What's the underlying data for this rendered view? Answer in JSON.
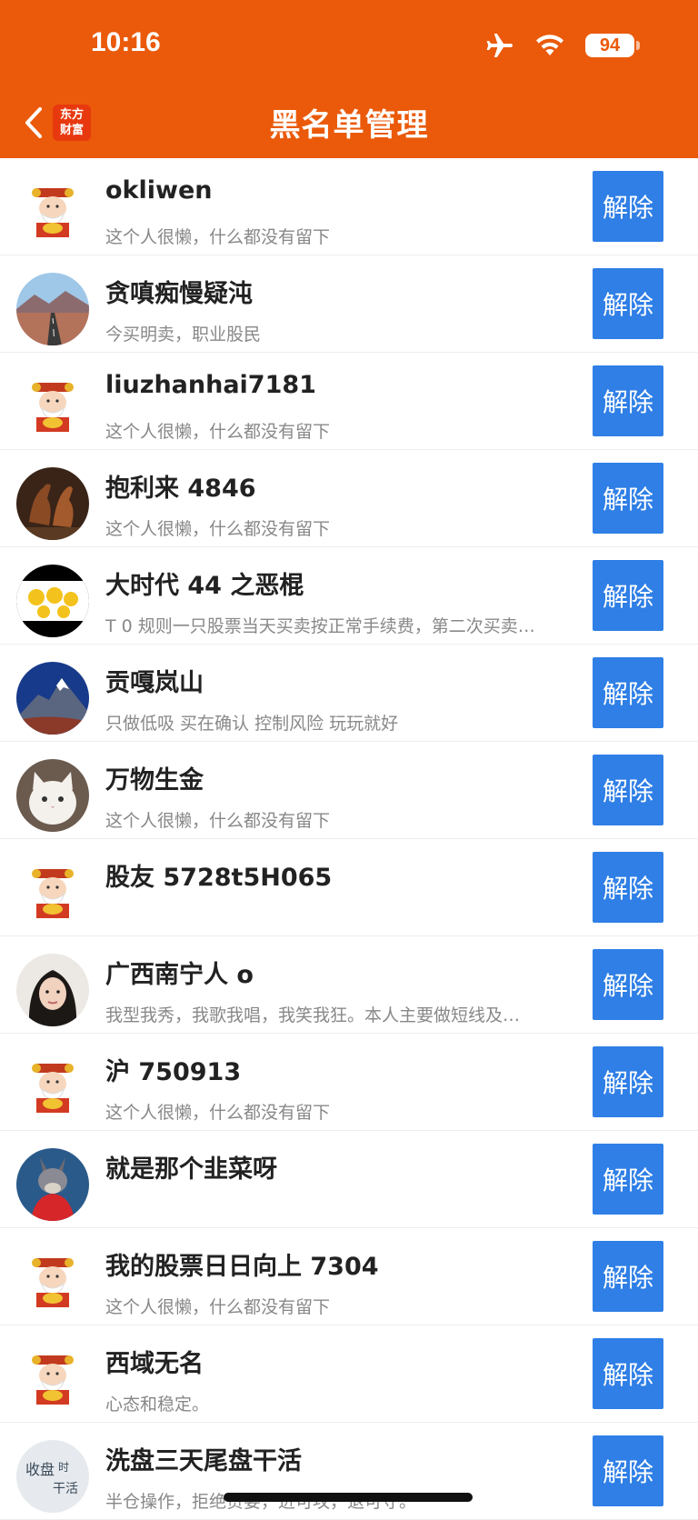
{
  "status_bar": {
    "time": "10:16",
    "battery": "94"
  },
  "header": {
    "logo": "东方\n财富",
    "title": "黑名单管理"
  },
  "users": [
    {
      "name": "okliwen",
      "bio": "这个人很懒，什么都没有留下",
      "avatar": "mascot",
      "button": "解除"
    },
    {
      "name": "贪嗔痴慢疑沌",
      "bio": "今买明卖，职业股民",
      "avatar": "road-landscape",
      "button": "解除"
    },
    {
      "name": "liuzhanhai7181",
      "bio": "这个人很懒，什么都没有留下",
      "avatar": "mascot",
      "button": "解除"
    },
    {
      "name": "抱利来 4846",
      "bio": "这个人很懒，什么都没有留下",
      "avatar": "horses",
      "button": "解除"
    },
    {
      "name": "大时代 44 之恶棍",
      "bio": "T 0 规则一只股票当天买卖按正常手续费，第二次买卖…",
      "avatar": "cartoon-chicks",
      "button": "解除"
    },
    {
      "name": "贡嘎岚山",
      "bio": "只做低吸 买在确认 控制风险 玩玩就好",
      "avatar": "snow-mountain",
      "button": "解除"
    },
    {
      "name": "万物生金",
      "bio": "这个人很懒，什么都没有留下",
      "avatar": "white-cat",
      "button": "解除"
    },
    {
      "name": "股友 5728t5H065",
      "bio": "",
      "avatar": "mascot",
      "button": "解除"
    },
    {
      "name": "广西南宁人 o",
      "bio": "我型我秀，我歌我唱，我笑我狂。本人主要做短线及…",
      "avatar": "woman-portrait",
      "button": "解除"
    },
    {
      "name": "沪 750913",
      "bio": "这个人很懒，什么都没有留下",
      "avatar": "mascot",
      "button": "解除"
    },
    {
      "name": "就是那个韭菜呀",
      "bio": "",
      "avatar": "donkey-cartoon",
      "button": "解除"
    },
    {
      "name": "我的股票日日向上 7304",
      "bio": "这个人很懒，什么都没有留下",
      "avatar": "mascot",
      "button": "解除"
    },
    {
      "name": "西域无名",
      "bio": "心态和稳定。",
      "avatar": "mascot",
      "button": "解除"
    },
    {
      "name": "洗盘三天尾盘干活",
      "bio": "半仓操作，拒绝贪婪，进可攻，退可守。",
      "avatar": "calligraphy",
      "button": "解除"
    }
  ],
  "calligraphy_avatar_text": "收盘时 干活"
}
